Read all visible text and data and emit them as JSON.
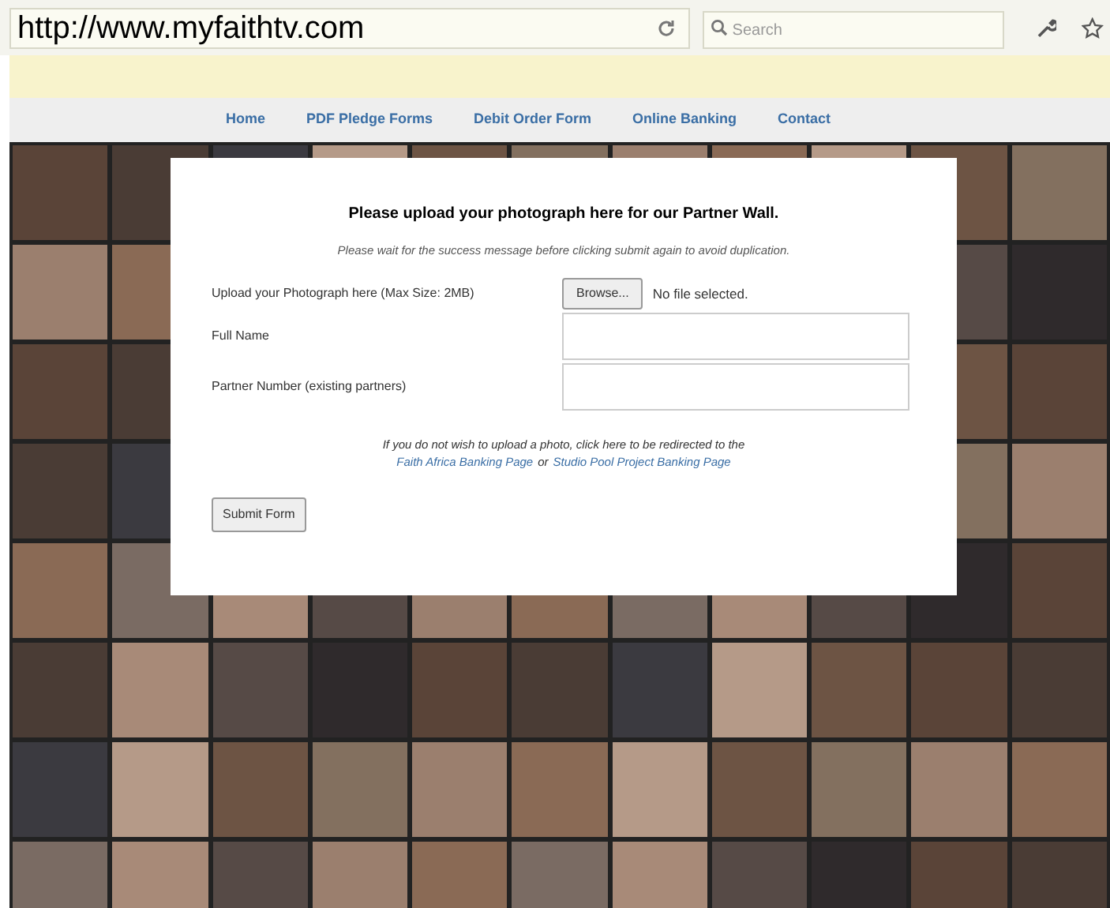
{
  "browser": {
    "url": "http://www.myfaithtv.com",
    "search": {
      "placeholder": "Search"
    }
  },
  "nav": [
    {
      "label": "Home"
    },
    {
      "label": "PDF Pledge Forms"
    },
    {
      "label": "Debit Order Form"
    },
    {
      "label": "Online Banking"
    },
    {
      "label": "Contact"
    }
  ],
  "form": {
    "title": "Please upload your photograph here for our Partner Wall.",
    "notice": "Please wait for the success message before clicking submit again to avoid duplication.",
    "upload": {
      "label": "Upload your Photograph here (Max Size: 2MB)",
      "button": "Browse...",
      "status": "No file selected."
    },
    "fields": [
      {
        "label": "Full Name"
      },
      {
        "label": "Partner Number (existing partners)"
      }
    ],
    "redirect": {
      "text": "If you do not wish to upload a photo, click here to be redirected to the",
      "links": [
        "Faith Africa Banking Page",
        "Studio Pool Project Banking Page"
      ],
      "joiner": "or"
    },
    "submit": "Submit Form"
  }
}
